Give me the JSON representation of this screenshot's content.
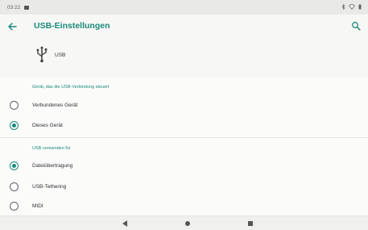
{
  "status_bar": {
    "time": "03:22"
  },
  "app_bar": {
    "title": "USB-Einstellungen"
  },
  "usb_header": {
    "label": "USB"
  },
  "section_control": {
    "title": "Gerät, das die USB-Verbindung steuert",
    "options": [
      {
        "label": "Verbundenes Gerät",
        "selected": false
      },
      {
        "label": "Dieses Gerät",
        "selected": true
      }
    ]
  },
  "section_usage": {
    "title": "USB verwenden für",
    "options": [
      {
        "label": "Dateiübertragung",
        "selected": true
      },
      {
        "label": "USB-Tethering",
        "selected": false
      },
      {
        "label": "MIDI",
        "selected": false
      }
    ]
  },
  "colors": {
    "accent": "#1a8a7a",
    "background": "#f7f7f5"
  },
  "icons": [
    "arrow-back-icon",
    "search-icon",
    "usb-icon",
    "nav-back-icon",
    "nav-home-icon",
    "nav-recents-icon"
  ]
}
